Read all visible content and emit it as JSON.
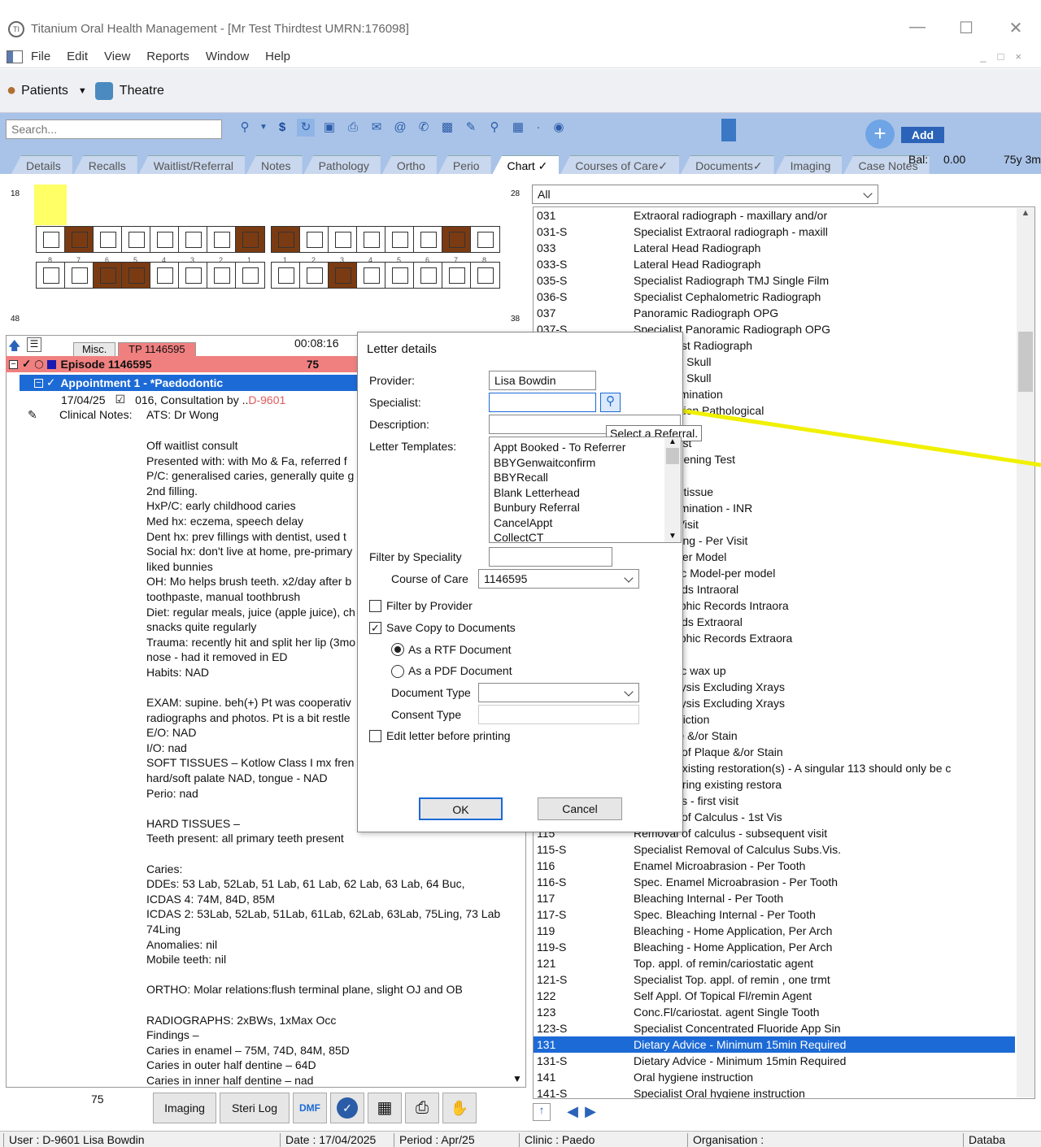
{
  "window": {
    "title": "Titanium Oral Health Management - [Mr Test Thirdtest  UMRN:176098]"
  },
  "menu": [
    "File",
    "Edit",
    "View",
    "Reports",
    "Window",
    "Help"
  ],
  "toolbar": {
    "patients": "Patients",
    "theatre": "Theatre"
  },
  "search": {
    "placeholder": "Search..."
  },
  "header_right": {
    "add": "Add",
    "bal_label": "Bal:",
    "bal_value": "0.00",
    "age": "75y 3m"
  },
  "tabs": [
    "Details",
    "Recalls",
    "Waitlist/Referral",
    "Notes",
    "Pathology",
    "Ortho",
    "Perio",
    "Chart",
    "Courses of Care",
    "Documents",
    "Imaging",
    "Case Notes"
  ],
  "active_tab": "Chart",
  "chart": {
    "q18": "18",
    "q28": "28",
    "q48": "48",
    "q38": "38",
    "upper_left_nums": [
      "8",
      "7",
      "6",
      "5",
      "4",
      "3",
      "2",
      "1"
    ],
    "upper_right_nums": [
      "1",
      "2",
      "3",
      "4",
      "5",
      "6",
      "7",
      "8"
    ]
  },
  "filter": {
    "value": "All"
  },
  "left": {
    "misc_tab": "Misc.",
    "tp_tab": "TP 1146595",
    "timer": "00:08:16",
    "episode": "Episode 1146595",
    "episode_num": "75",
    "appointment": "Appointment 1 - *Paedodontic",
    "visit_date": "17/04/25",
    "visit_item": "016, Consultation by ..",
    "visit_code": "D-9601",
    "clinical_label": "Clinical Notes:",
    "clinical_first": "ATS: Dr Wong",
    "notes": "Off waitlist consult\nPresented with: with Mo & Fa, referred f\nP/C: generalised caries, generally quite g\n2nd filling.\nHxP/C: early childhood caries\nMed hx: eczema, speech delay\nDent hx: prev fillings with dentist, used t\nSocial hx: don't live at home, pre-primary\nliked bunnies\nOH: Mo helps brush teeth. x2/day after b\ntoothpaste, manual toothbrush\nDiet: regular meals, juice (apple juice), ch\nsnacks quite regularly\nTrauma: recently hit and split her lip (3mo\nnose - had it removed in ED\nHabits: NAD\n\nEXAM: supine. beh(+) Pt was cooperativ\nradiographs and photos. Pt is a bit restle\nE/O: NAD\nI/O: nad\nSOFT TISSUES – Kotlow Class I mx fren\nhard/soft palate NAD, tongue - NAD\nPerio: nad\n\nHARD TISSUES –\nTeeth present: all primary teeth present\n\nCaries:\nDDEs: 53 Lab, 52Lab, 51 Lab, 61 Lab, 62 Lab, 63 Lab, 64 Buc,\nICDAS 4: 74M, 84D, 85M\nICDAS 2: 53Lab, 52Lab, 51Lab, 61Lab, 62Lab, 63Lab, 75Ling, 73 Lab\n74Ling\nAnomalies: nil\nMobile teeth: nil\n\nORTHO: Molar relations:flush terminal plane, slight OJ and OB\n\nRADIOGRAPHS: 2xBWs, 1xMax Occ\nFindings –\nCaries in enamel – 75M, 74D, 84M, 85D\nCaries in outer half dentine – 64D\nCaries in inner half dentine – nad"
  },
  "procedures": [
    {
      "code": "031",
      "desc": "Extraoral radiograph - maxillary and/or"
    },
    {
      "code": "031-S",
      "desc": "Specialist Extraoral radiograph - maxill"
    },
    {
      "code": "033",
      "desc": "Lateral Head Radiograph"
    },
    {
      "code": "033-S",
      "desc": "Lateral Head Radiograph"
    },
    {
      "code": "035-S",
      "desc": "Specialist Radiograph TMJ Single Film"
    },
    {
      "code": "036-S",
      "desc": "Specialist Cephalometric Radiograph"
    },
    {
      "code": "037",
      "desc": "Panoramic Radiograph OPG"
    },
    {
      "code": "037-S",
      "desc": "Specialist Panoramic Radiograph OPG"
    },
    {
      "code": "",
      "desc": "Hand-Wrist Radiograph"
    },
    {
      "code": "",
      "desc": "hy Of The Skull"
    },
    {
      "code": "",
      "desc": "hy Of The Skull"
    },
    {
      "code": "",
      "desc": "gical Examination"
    },
    {
      "code": "",
      "desc": "ve Collection Pathological"
    },
    {
      "code": "",
      "desc": "ning Test"
    },
    {
      "code": "",
      "desc": "eening Test"
    },
    {
      "code": "",
      "desc": "gical Screening Test"
    },
    {
      "code": "",
      "desc": "tissue"
    },
    {
      "code": "",
      "desc": "Biopsy of tissue"
    },
    {
      "code": "",
      "desc": "gical Examination - INR"
    },
    {
      "code": "",
      "desc": "ng - Per Visit"
    },
    {
      "code": "",
      "desc": "Pulp Testing - Per Visit"
    },
    {
      "code": "",
      "desc": "Model - Per Model"
    },
    {
      "code": "",
      "desc": "Diagnostic Model-per model"
    },
    {
      "code": "",
      "desc": "hic Records Intraoral"
    },
    {
      "code": "",
      "desc": "Photographic Records Intraora"
    },
    {
      "code": "",
      "desc": "hic Records Extraoral"
    },
    {
      "code": "",
      "desc": "Photographic Records Extraora"
    },
    {
      "code": "",
      "desc": "wax up"
    },
    {
      "code": "",
      "desc": "Diagnostic wax up"
    },
    {
      "code": "",
      "desc": "etric Analysis Excluding Xrays"
    },
    {
      "code": "",
      "desc": "etric Analysis Excluding Xrays"
    },
    {
      "code": "",
      "desc": "Size Prediction"
    },
    {
      "code": "",
      "desc": "Of Plaque &/or Stain"
    },
    {
      "code": "",
      "desc": "Removal of Plaque &/or Stain"
    },
    {
      "code": "",
      "desc": "ring pre-existing restoration(s) - A singular 113 should only be c"
    },
    {
      "code": "",
      "desc": "Recontouring existing restora"
    },
    {
      "code": "",
      "desc": "of  calculus - first visit"
    },
    {
      "code": "",
      "desc": "Removal of Calculus - 1st Vis"
    },
    {
      "code": "115",
      "desc": "Removal of calculus - subsequent visit"
    },
    {
      "code": "115-S",
      "desc": "Specialist Removal of Calculus Subs.Vis."
    },
    {
      "code": "116",
      "desc": " Enamel Microabrasion - Per Tooth"
    },
    {
      "code": "116-S",
      "desc": "Spec. Enamel Microabrasion - Per Tooth"
    },
    {
      "code": "117",
      "desc": "Bleaching Internal - Per Tooth"
    },
    {
      "code": "117-S",
      "desc": "Spec. Bleaching Internal - Per Tooth"
    },
    {
      "code": "119",
      "desc": "Bleaching - Home Application, Per Arch"
    },
    {
      "code": "119-S",
      "desc": "Bleaching - Home Application, Per Arch"
    },
    {
      "code": "121",
      "desc": "Top. appl. of remin/cariostatic agent"
    },
    {
      "code": "121-S",
      "desc": "Specialist Top. appl. of remin , one trmt"
    },
    {
      "code": "122",
      "desc": "Self Appl. Of Topical Fl/remin Agent"
    },
    {
      "code": "123",
      "desc": "Conc.Fl/cariostat. agent  Single Tooth"
    },
    {
      "code": "123-S",
      "desc": "Specialist Concentrated Fluoride App Sin"
    },
    {
      "code": "131",
      "desc": "Dietary Advice - Minimum 15min Required"
    },
    {
      "code": "131-S",
      "desc": "Dietary Advice - Minimum 15min Required"
    },
    {
      "code": "141",
      "desc": "Oral hygiene instruction"
    },
    {
      "code": "141-S",
      "desc": "Specialist Oral hygiene instruction"
    }
  ],
  "selected_code": "131",
  "dialog": {
    "title": "Letter details",
    "provider_label": "Provider:",
    "provider_value": "Lisa Bowdin",
    "specialist_label": "Specialist:",
    "specialist_value": "",
    "description_label": "Description:",
    "description_value": "",
    "tooltip": "Select a Referral.",
    "templates_label": "Letter Templates:",
    "templates": [
      "Appt Booked - To Referrer",
      "BBYGenwaitconfirm",
      "BBYRecall",
      "Blank Letterhead",
      "Bunbury Referral",
      "CancelAppt",
      "CollectCT"
    ],
    "filter_speciality_label": "Filter by Speciality",
    "filter_speciality_value": "",
    "course_label": "Course of Care",
    "course_value": "1146595",
    "filter_provider_label": "Filter by Provider",
    "save_copy_label": "Save Copy to Documents",
    "rtf_label": "As a RTF Document",
    "pdf_label": "As a PDF Document",
    "doc_type_label": "Document Type",
    "doc_type_value": "",
    "consent_label": "Consent Type",
    "consent_value": "",
    "edit_label": "Edit letter before printing",
    "ok": "OK",
    "cancel": "Cancel"
  },
  "bottom": {
    "count": "75",
    "imaging": "Imaging",
    "sterilog": "Steri Log",
    "dmf": "DMF"
  },
  "status": {
    "user": "User : D-9601  Lisa Bowdin",
    "date": "Date : 17/04/2025",
    "period": "Period : Apr/25",
    "clinic": "Clinic : Paedo",
    "org": "Organisation :",
    "db": "Databa"
  },
  "colors": {
    "accent": "#1c6ad6",
    "episode_bg": "#f08080",
    "tabbar": "#a9c3e8",
    "arrow": "#f0f000"
  }
}
